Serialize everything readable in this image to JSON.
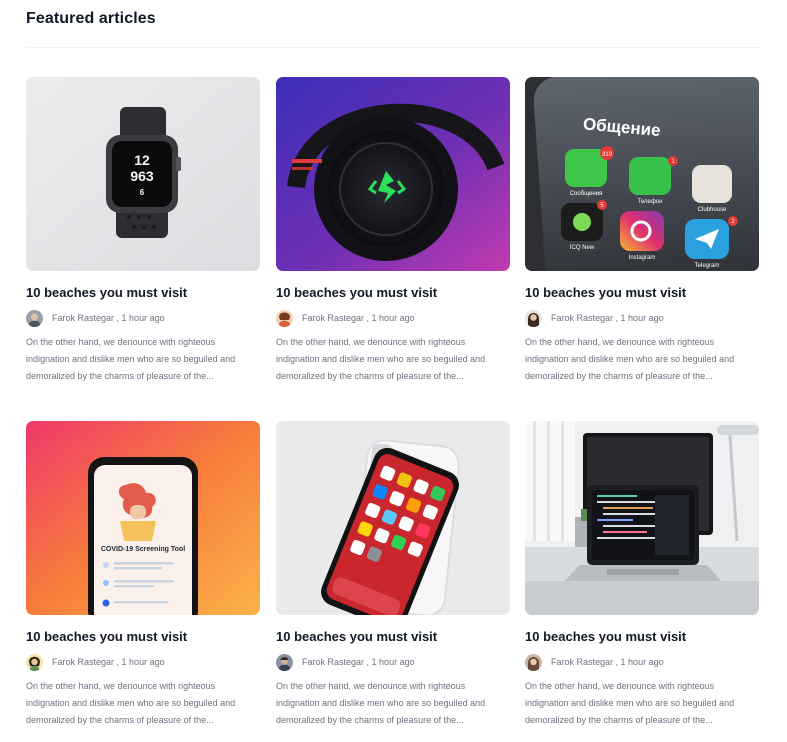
{
  "section": {
    "title": "Featured articles"
  },
  "articles": [
    {
      "title": "10 beaches you must visit",
      "author": "Farok Rastegar",
      "time": "1 hour ago",
      "excerpt": "On the other hand, we denounce with righteous indignation and dislike men who are so beguiled and demoralized by the charms of pleasure of the...",
      "image": "smartwatch"
    },
    {
      "title": "10 beaches you must visit",
      "author": "Farok Rastegar",
      "time": "1 hour ago",
      "excerpt": "On the other hand, we denounce with righteous indignation and dislike men who are so beguiled and demoralized by the charms of pleasure of the...",
      "image": "gaming-headphones"
    },
    {
      "title": "10 beaches you must visit",
      "author": "Farok Rastegar",
      "time": "1 hour ago",
      "excerpt": "On the other hand, we denounce with righteous indignation and dislike men who are so beguiled and demoralized by the charms of pleasure of the...",
      "image": "phone-apps",
      "image_text": {
        "heading": "Общение",
        "apps": [
          "Сообщения",
          "Телефон",
          "Clubhouse",
          "ICQ New",
          "Instagram",
          "Telegram"
        ],
        "badges": [
          "319",
          "1",
          "5",
          "2"
        ]
      }
    },
    {
      "title": "10 beaches you must visit",
      "author": "Farok Rastegar",
      "time": "1 hour ago",
      "excerpt": "On the other hand, we denounce with righteous indignation and dislike men who are so beguiled and demoralized by the charms of pleasure of the...",
      "image": "covid-app",
      "image_text": {
        "heading": "COVID-19 Screening Tool"
      }
    },
    {
      "title": "10 beaches you must visit",
      "author": "Farok Rastegar",
      "time": "1 hour ago",
      "excerpt": "On the other hand, we denounce with righteous indignation and dislike men who are so beguiled and demoralized by the charms of pleasure of the...",
      "image": "smartphone"
    },
    {
      "title": "10 beaches you must visit",
      "author": "Farok Rastegar",
      "time": "1 hour ago",
      "excerpt": "On the other hand, we denounce with righteous indignation and dislike men who are so beguiled and demoralized by the charms of pleasure of the...",
      "image": "laptop-desk"
    }
  ],
  "colors": {
    "title": "#111827",
    "meta": "#6b7280",
    "divider": "#f1f3f5"
  }
}
